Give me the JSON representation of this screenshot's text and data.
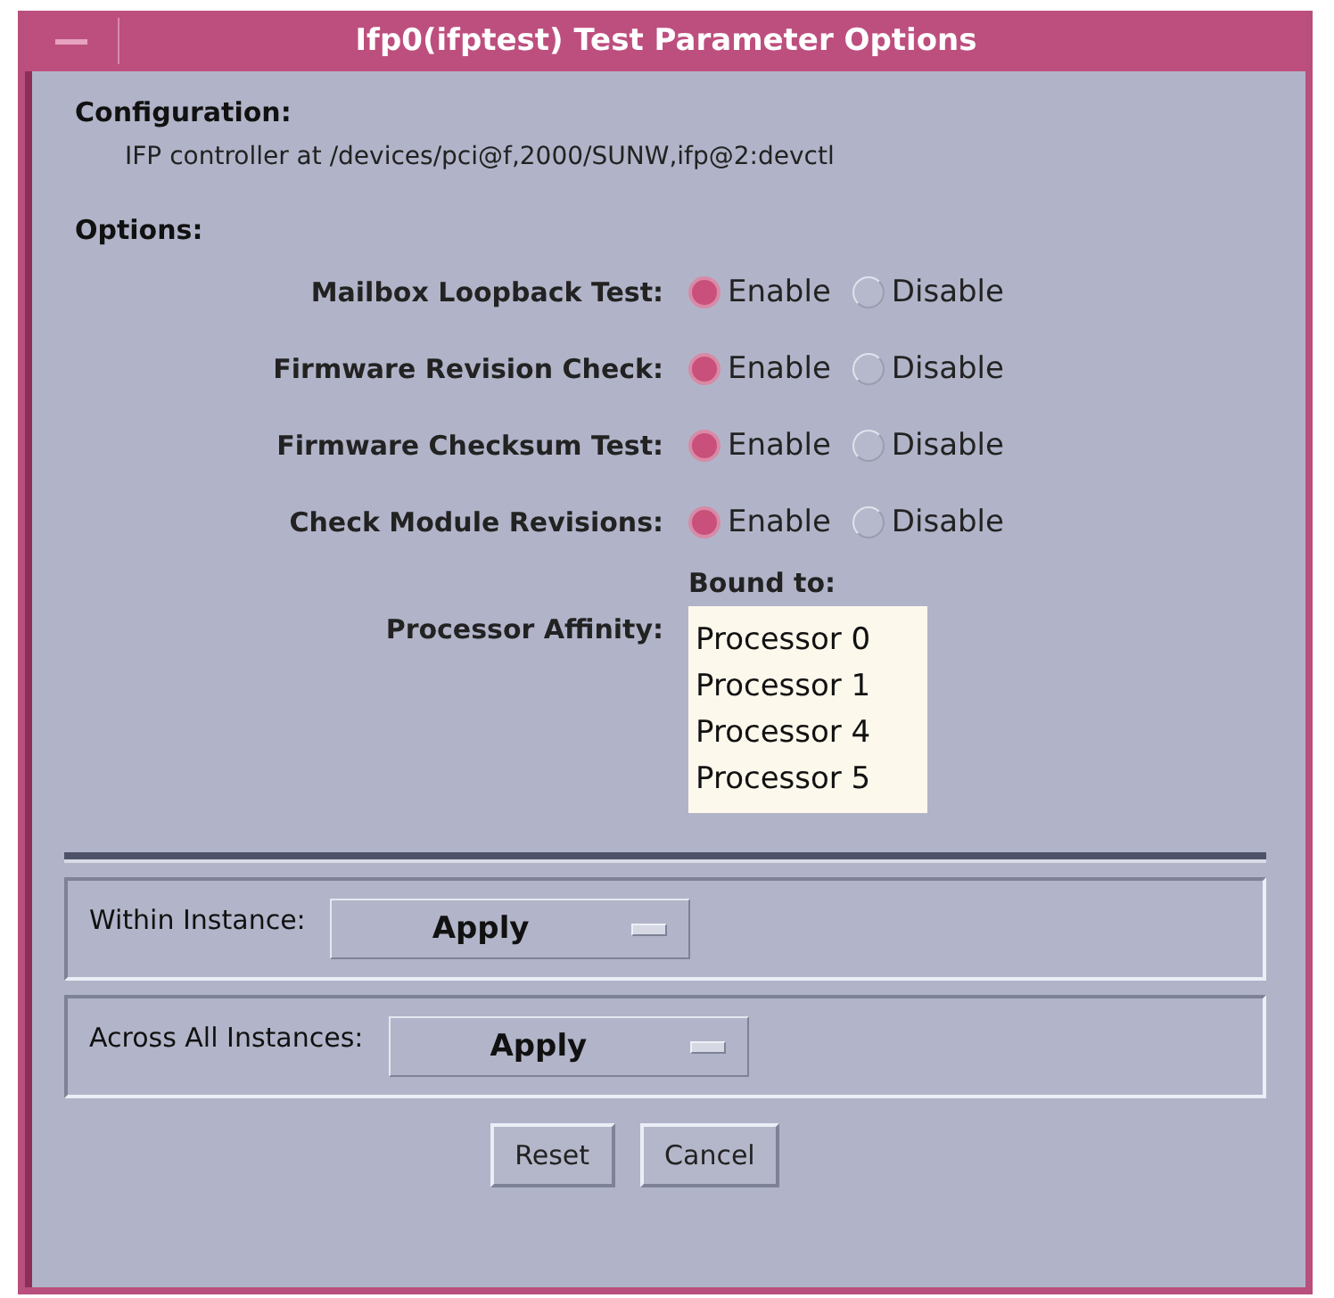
{
  "window": {
    "title": "Ifp0(ifptest) Test Parameter Options"
  },
  "configuration": {
    "label": "Configuration:",
    "value": "IFP controller at /devices/pci@f,2000/SUNW,ifp@2:devctl"
  },
  "options_label": "Options:",
  "options": [
    {
      "label": "Mailbox Loopback Test:",
      "choices": [
        {
          "label": "Enable",
          "selected": true
        },
        {
          "label": "Disable",
          "selected": false
        }
      ]
    },
    {
      "label": "Firmware Revision Check:",
      "choices": [
        {
          "label": "Enable",
          "selected": true
        },
        {
          "label": "Disable",
          "selected": false
        }
      ]
    },
    {
      "label": "Firmware Checksum Test:",
      "choices": [
        {
          "label": "Enable",
          "selected": true
        },
        {
          "label": "Disable",
          "selected": false
        }
      ]
    },
    {
      "label": "Check Module Revisions:",
      "choices": [
        {
          "label": "Enable",
          "selected": true
        },
        {
          "label": "Disable",
          "selected": false
        }
      ]
    }
  ],
  "processor_affinity": {
    "label": "Processor Affinity:",
    "list_label": "Bound to:",
    "items": [
      "Processor 0",
      "Processor 1",
      "Processor 4",
      "Processor 5"
    ]
  },
  "apply_groups": [
    {
      "label": "Within Instance:",
      "menu": "Apply"
    },
    {
      "label": "Across All Instances:",
      "menu": "Apply"
    }
  ],
  "buttons": [
    "Reset",
    "Cancel"
  ]
}
